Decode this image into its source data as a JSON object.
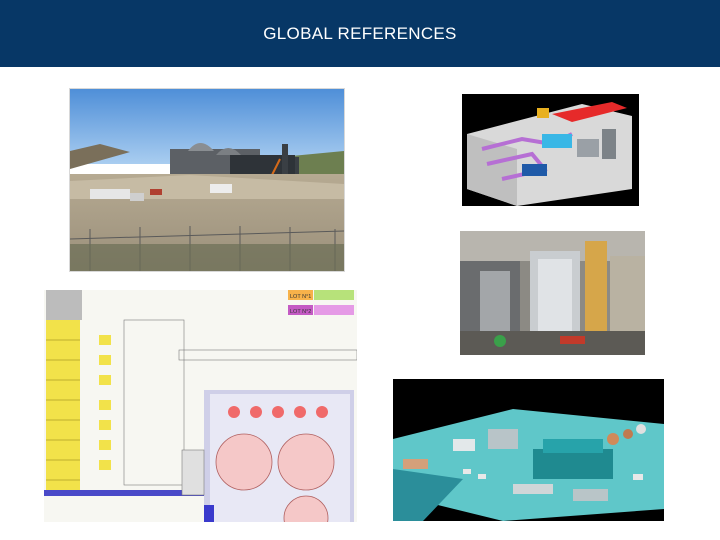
{
  "header": {
    "title": "GLOBAL REFERENCES"
  },
  "colors": {
    "header_bg": "#073766",
    "title_text": "#ffffff",
    "page_bg": "#ffffff"
  },
  "images": [
    {
      "name": "construction-site-photo"
    },
    {
      "name": "equipment-3d-model"
    },
    {
      "name": "industrial-plant-photo"
    },
    {
      "name": "site-layout-plan"
    },
    {
      "name": "facility-3d-aerial-render"
    }
  ],
  "plan_labels": {
    "lot1": "LOT N°1",
    "lot2": "LOT N°2"
  }
}
